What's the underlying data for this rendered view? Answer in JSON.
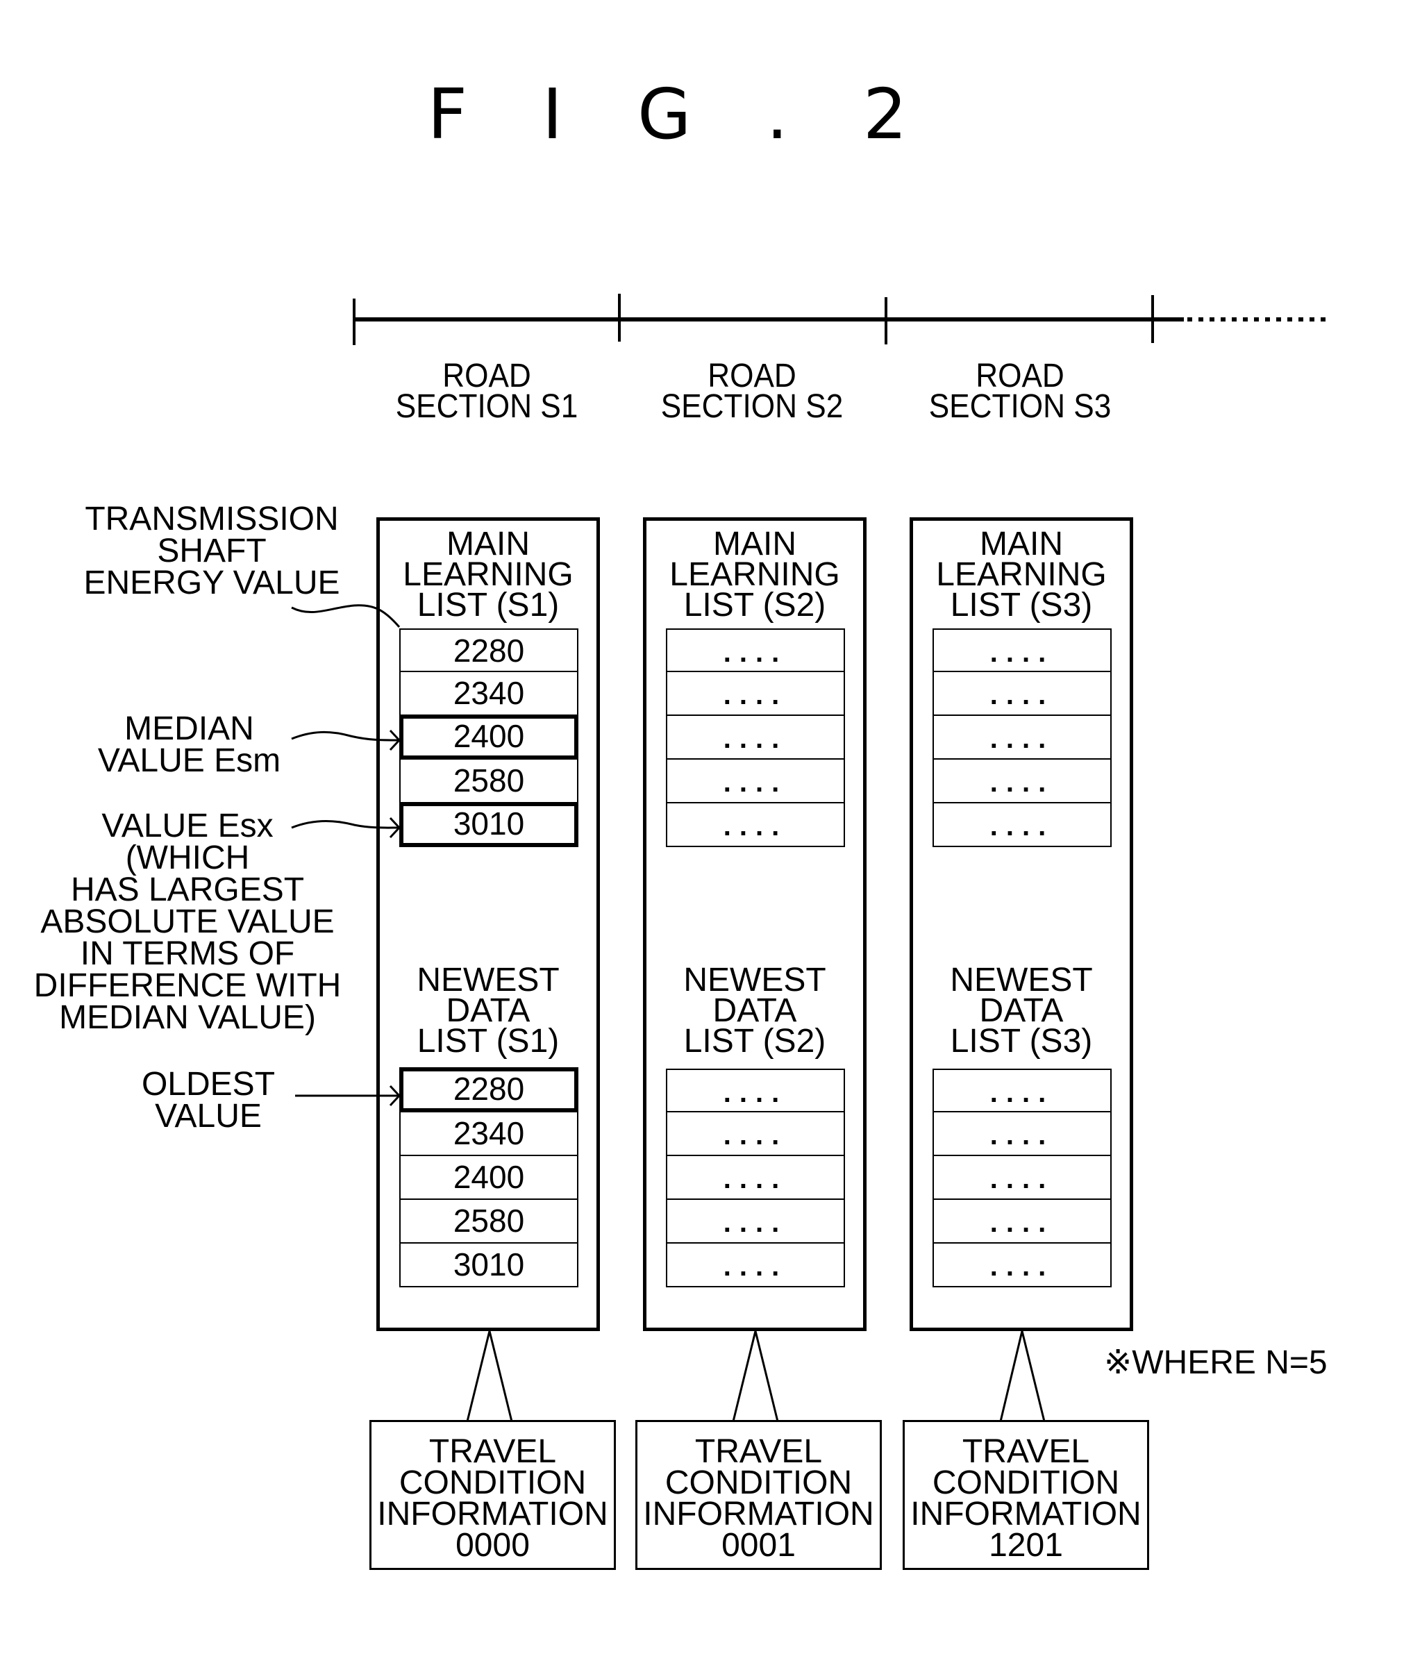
{
  "figure": {
    "title": "F I G . 2"
  },
  "road_sections": [
    {
      "id": "S1",
      "label_line1": "ROAD",
      "label_line2": "SECTION S1"
    },
    {
      "id": "S2",
      "label_line1": "ROAD",
      "label_line2": "SECTION S2"
    },
    {
      "id": "S3",
      "label_line1": "ROAD",
      "label_line2": "SECTION S3"
    }
  ],
  "columns": [
    {
      "id": "S1",
      "main_heading": [
        "MAIN",
        "LEARNING",
        "LIST (S1)"
      ],
      "main_list": [
        "2280",
        "2340",
        "2400",
        "2580",
        "3010"
      ],
      "main_highlight": [
        false,
        false,
        true,
        false,
        true
      ],
      "newest_heading": [
        "NEWEST",
        "DATA",
        "LIST (S1)"
      ],
      "newest_list": [
        "2280",
        "2340",
        "2400",
        "2580",
        "3010"
      ],
      "newest_highlight": [
        true,
        false,
        false,
        false,
        false
      ],
      "travel": [
        "TRAVEL",
        "CONDITION",
        "INFORMATION",
        "0000"
      ]
    },
    {
      "id": "S2",
      "main_heading": [
        "MAIN",
        "LEARNING",
        "LIST (S2)"
      ],
      "main_list": [
        "....",
        "....",
        "....",
        "....",
        "...."
      ],
      "main_highlight": [
        false,
        false,
        false,
        false,
        false
      ],
      "newest_heading": [
        "NEWEST",
        "DATA",
        "LIST (S2)"
      ],
      "newest_list": [
        "....",
        "....",
        "....",
        "....",
        "...."
      ],
      "newest_highlight": [
        false,
        false,
        false,
        false,
        false
      ],
      "travel": [
        "TRAVEL",
        "CONDITION",
        "INFORMATION",
        "0001"
      ]
    },
    {
      "id": "S3",
      "main_heading": [
        "MAIN",
        "LEARNING",
        "LIST (S3)"
      ],
      "main_list": [
        "....",
        "....",
        "....",
        "....",
        "...."
      ],
      "main_highlight": [
        false,
        false,
        false,
        false,
        false
      ],
      "newest_heading": [
        "NEWEST",
        "DATA",
        "LIST (S3)"
      ],
      "newest_list": [
        "....",
        "....",
        "....",
        "....",
        "...."
      ],
      "newest_highlight": [
        false,
        false,
        false,
        false,
        false
      ],
      "travel": [
        "TRAVEL",
        "CONDITION",
        "INFORMATION",
        "1201"
      ]
    }
  ],
  "annotations": {
    "energy_value": [
      "TRANSMISSION",
      "SHAFT",
      "ENERGY VALUE"
    ],
    "median": [
      "MEDIAN",
      "VALUE Esm"
    ],
    "esx": [
      "VALUE Esx",
      "(WHICH",
      "HAS LARGEST",
      "ABSOLUTE VALUE",
      "IN TERMS OF",
      "DIFFERENCE WITH",
      "MEDIAN VALUE)"
    ],
    "oldest": [
      "OLDEST",
      "VALUE"
    ]
  },
  "note": "※WHERE N=5"
}
